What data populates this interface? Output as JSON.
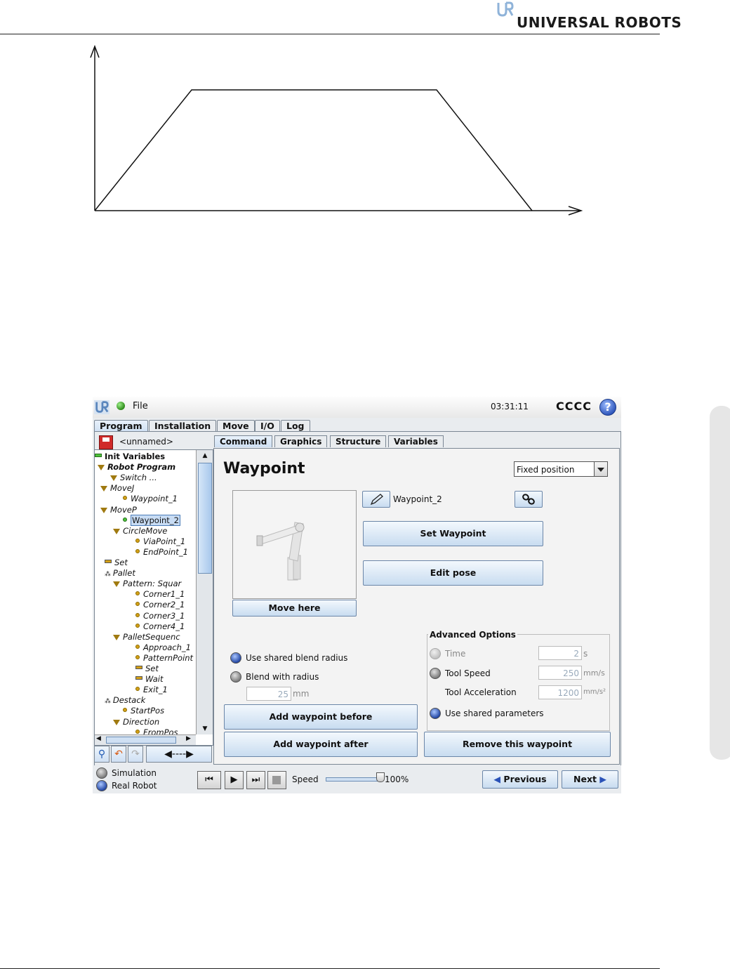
{
  "page": {
    "brand": "UNIVERSAL ROBOTS",
    "brand_color": "#1a1a1a"
  },
  "figure": {
    "type": "line",
    "description_marks": "trapezoidal profile with x and y axes (no labels)"
  },
  "screen": {
    "file_label": "File",
    "clock": "03:31:11",
    "robot_name": "CCCC",
    "help_label": "?",
    "main_tabs": [
      "Program",
      "Installation",
      "Move",
      "I/O",
      "Log"
    ],
    "active_main_tab": "Program",
    "program_name": "<unnamed>",
    "tree": [
      {
        "label": "Init Variables",
        "kind": "green-bar",
        "style": "bold"
      },
      {
        "label": "Robot Program",
        "kind": "triangle",
        "style": "bold-italic"
      },
      {
        "label": "Switch ...",
        "kind": "triangle",
        "style": "italic"
      },
      {
        "label": "MoveJ",
        "kind": "triangle",
        "style": "italic"
      },
      {
        "label": "Waypoint_1",
        "kind": "dot",
        "style": "italic"
      },
      {
        "label": "MoveP",
        "kind": "triangle",
        "style": "italic"
      },
      {
        "label": "Waypoint_2",
        "kind": "dot-green",
        "style": "selected"
      },
      {
        "label": "CircleMove",
        "kind": "triangle",
        "style": "italic"
      },
      {
        "label": "ViaPoint_1",
        "kind": "dot",
        "style": "italic"
      },
      {
        "label": "EndPoint_1",
        "kind": "dot",
        "style": "italic"
      },
      {
        "label": "Set",
        "kind": "bar",
        "style": "italic"
      },
      {
        "label": "Pallet",
        "kind": "pallet",
        "style": "italic"
      },
      {
        "label": "Pattern: Squar",
        "kind": "triangle",
        "style": "italic"
      },
      {
        "label": "Corner1_1",
        "kind": "dot",
        "style": "italic"
      },
      {
        "label": "Corner2_1",
        "kind": "dot",
        "style": "italic"
      },
      {
        "label": "Corner3_1",
        "kind": "dot",
        "style": "italic"
      },
      {
        "label": "Corner4_1",
        "kind": "dot",
        "style": "italic"
      },
      {
        "label": "PalletSequenc",
        "kind": "triangle",
        "style": "italic"
      },
      {
        "label": "Approach_1",
        "kind": "dot",
        "style": "italic"
      },
      {
        "label": "PatternPoint",
        "kind": "dot",
        "style": "italic"
      },
      {
        "label": "Set",
        "kind": "bar",
        "style": "italic"
      },
      {
        "label": "Wait",
        "kind": "bar",
        "style": "italic"
      },
      {
        "label": "Exit_1",
        "kind": "dot",
        "style": "italic"
      },
      {
        "label": "Destack",
        "kind": "pallet",
        "style": "italic"
      },
      {
        "label": "StartPos",
        "kind": "dot",
        "style": "italic"
      },
      {
        "label": "Direction",
        "kind": "triangle",
        "style": "italic"
      },
      {
        "label": "FromPos",
        "kind": "dot",
        "style": "italic"
      }
    ],
    "sub_tabs": [
      "Command",
      "Graphics",
      "Structure",
      "Variables"
    ],
    "active_sub_tab": "Command",
    "command": {
      "title": "Waypoint",
      "position_mode": "Fixed position",
      "waypoint_name": "Waypoint_2",
      "set_waypoint": "Set Waypoint",
      "edit_pose": "Edit pose",
      "move_here": "Move here",
      "blend_shared": "Use shared blend radius",
      "blend_radius": "Blend with radius",
      "blend_value": "25",
      "blend_unit": "mm",
      "advanced_title": "Advanced Options",
      "time_label": "Time",
      "time_value": "2",
      "time_unit": "s",
      "tool_speed_label": "Tool Speed",
      "tool_speed_value": "250",
      "tool_speed_unit": "mm/s",
      "tool_accel_label": "Tool Acceleration",
      "tool_accel_value": "1200",
      "tool_accel_unit": "mm/s²",
      "shared_params": "Use shared parameters",
      "add_before": "Add waypoint before",
      "add_after": "Add waypoint after",
      "remove": "Remove this waypoint"
    },
    "bottom": {
      "simulation": "Simulation",
      "real_robot": "Real Robot",
      "speed_label": "Speed",
      "speed_value": "100%",
      "speed_fraction": 1.0,
      "previous": "Previous",
      "next": "Next"
    },
    "colors": {
      "accent_blue": "#2a52b8",
      "status_green": "#2d8a1a"
    }
  }
}
